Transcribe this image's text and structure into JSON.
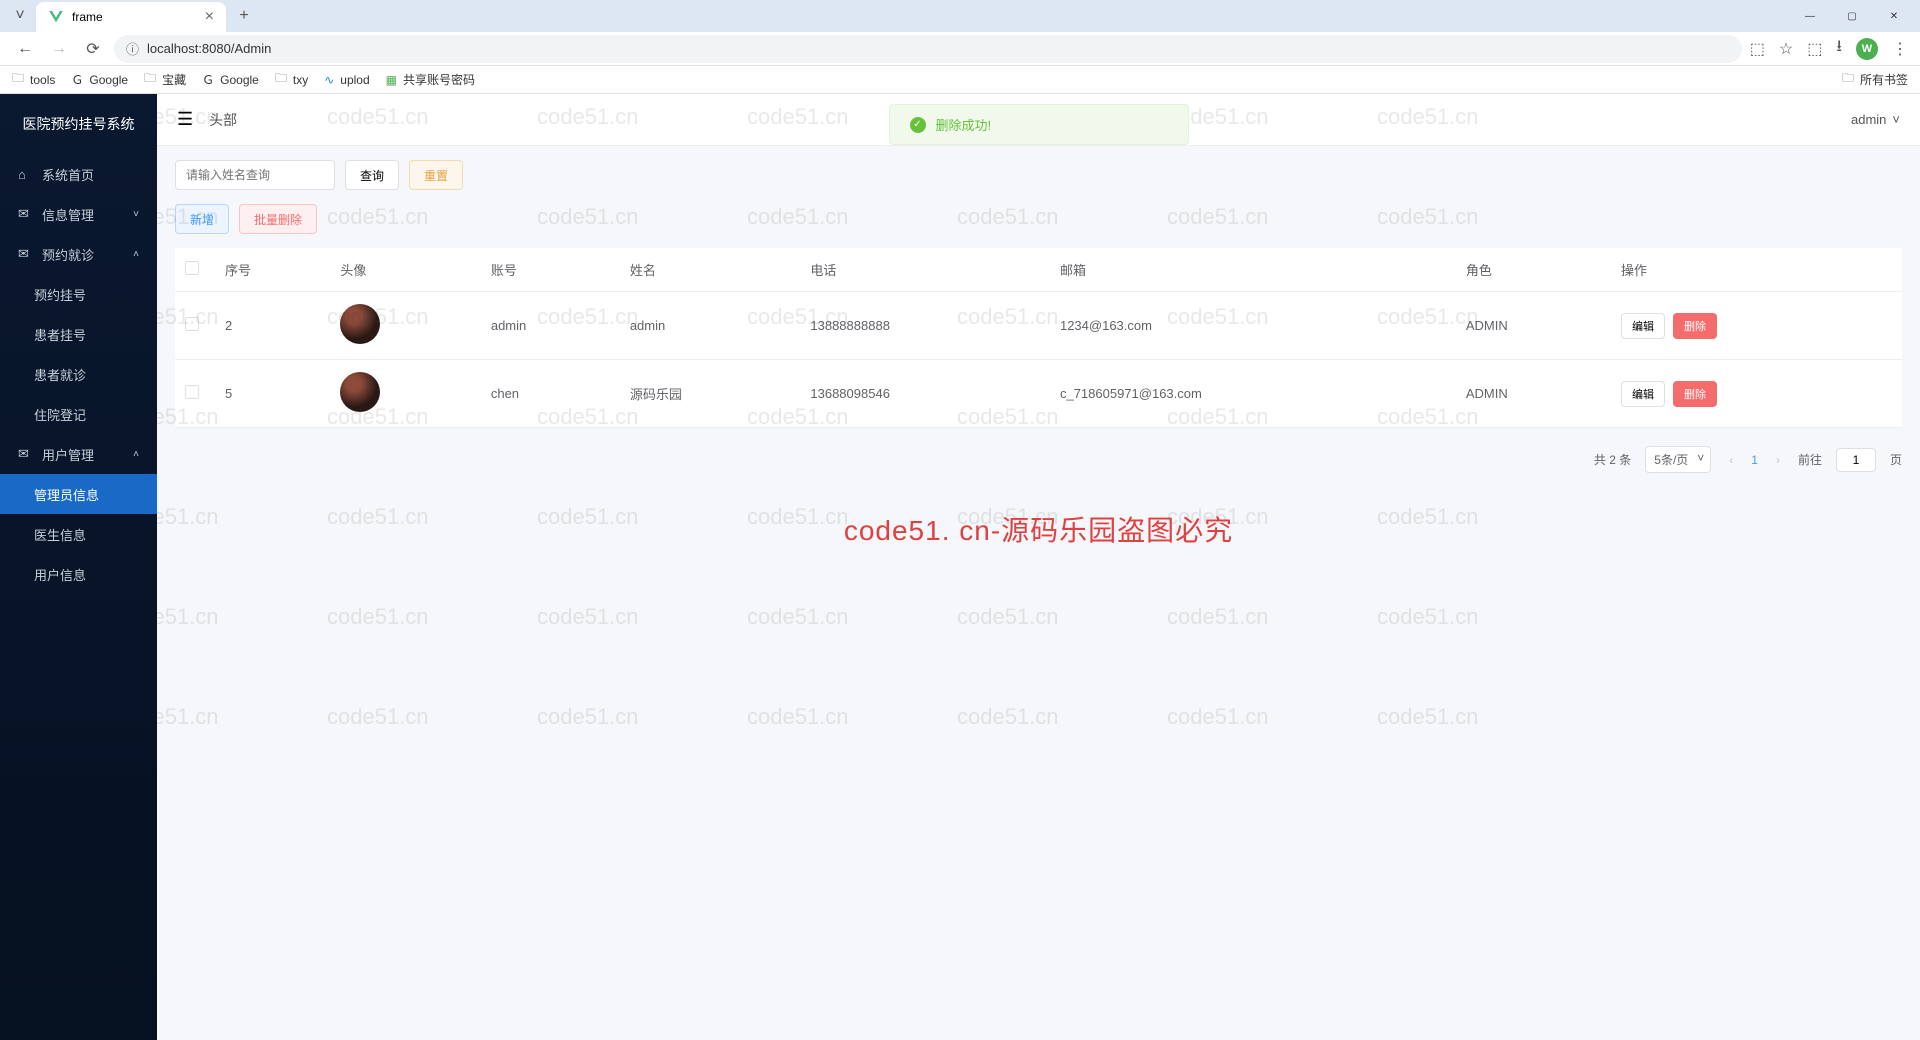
{
  "browser": {
    "tab_title": "frame",
    "url": "localhost:8080/Admin",
    "profile_initial": "W",
    "bookmarks": [
      "tools",
      "Google",
      "宝藏",
      "Google",
      "txy",
      "uplod",
      "共享账号密码"
    ],
    "all_bookmarks": "所有书签"
  },
  "sidebar": {
    "title": "医院预约挂号系统",
    "items": [
      {
        "label": "系统首页",
        "icon": "⌂"
      },
      {
        "label": "信息管理",
        "icon": "✉",
        "arrow": "˅"
      },
      {
        "label": "预约就诊",
        "icon": "✉",
        "arrow": "˄"
      },
      {
        "label": "预约挂号",
        "sub": true
      },
      {
        "label": "患者挂号",
        "sub": true
      },
      {
        "label": "患者就诊",
        "sub": true
      },
      {
        "label": "住院登记",
        "sub": true
      },
      {
        "label": "用户管理",
        "icon": "✉",
        "arrow": "˄"
      },
      {
        "label": "管理员信息",
        "sub": true,
        "active": true
      },
      {
        "label": "医生信息",
        "sub": true
      },
      {
        "label": "用户信息",
        "sub": true
      }
    ]
  },
  "header": {
    "breadcrumb": "头部",
    "user": "admin"
  },
  "toast": {
    "msg": "删除成功!"
  },
  "search": {
    "placeholder": "请输入姓名查询",
    "btn_query": "查询",
    "btn_reset": "重置"
  },
  "actions": {
    "add": "新增",
    "batch_delete": "批量删除"
  },
  "table": {
    "headers": [
      "序号",
      "头像",
      "账号",
      "姓名",
      "电话",
      "邮箱",
      "角色",
      "操作"
    ],
    "edit": "编辑",
    "delete": "删除",
    "rows": [
      {
        "seq": "2",
        "account": "admin",
        "name": "admin",
        "phone": "13888888888",
        "email": "1234@163.com",
        "role": "ADMIN"
      },
      {
        "seq": "5",
        "account": "chen",
        "name": "源码乐园",
        "phone": "13688098546",
        "email": "c_718605971@163.com",
        "role": "ADMIN"
      }
    ]
  },
  "pagination": {
    "total": "共 2 条",
    "per_page": "5条/页",
    "current": "1",
    "goto": "前往",
    "page_suffix": "页",
    "goto_value": "1"
  },
  "watermark": {
    "repeat": "code51.cn",
    "center": "code51. cn-源码乐园盗图必究"
  }
}
